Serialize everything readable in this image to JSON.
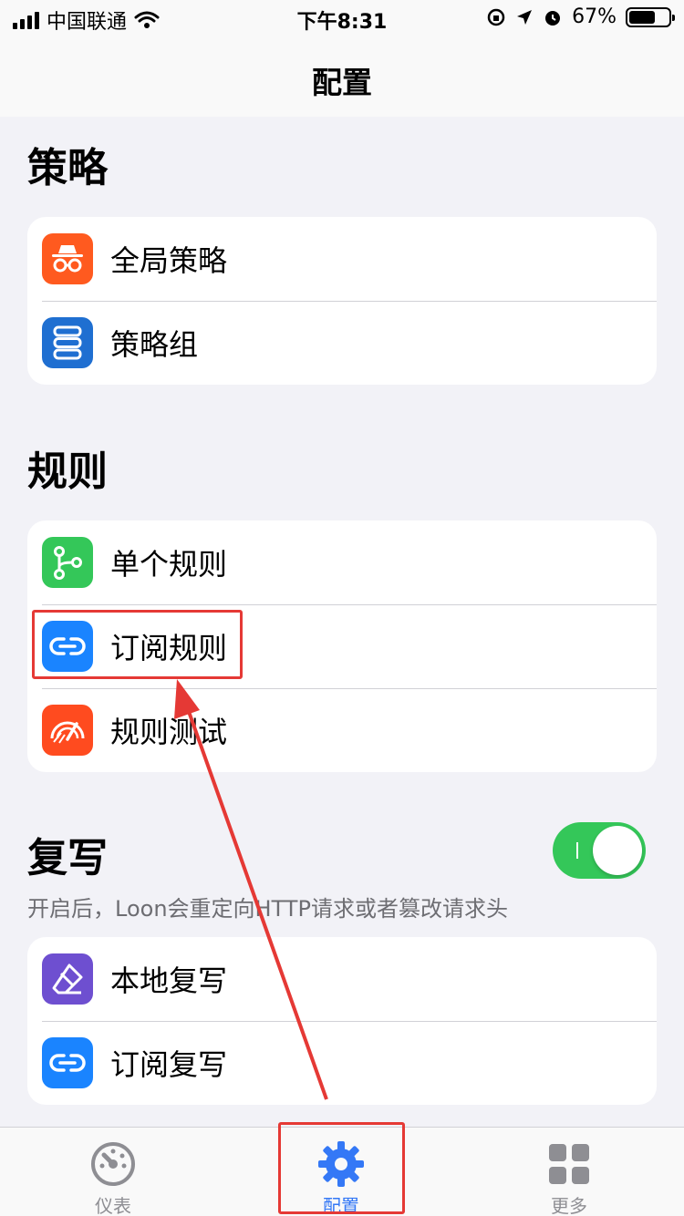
{
  "status": {
    "carrier": "中国联通",
    "time": "下午8:31",
    "battery_percent": "67%",
    "battery_level": 0.67
  },
  "nav": {
    "title": "配置"
  },
  "sections": {
    "strategy": {
      "title": "策略",
      "items": [
        {
          "label": "全局策略",
          "icon": "incognito-icon",
          "color": "#ff5a1f"
        },
        {
          "label": "策略组",
          "icon": "server-stack-icon",
          "color": "#1f6fd1"
        }
      ]
    },
    "rules": {
      "title": "规则",
      "items": [
        {
          "label": "单个规则",
          "icon": "branch-icon",
          "color": "#34c759"
        },
        {
          "label": "订阅规则",
          "icon": "link-icon",
          "color": "#1a84ff"
        },
        {
          "label": "规则测试",
          "icon": "speedometer-icon",
          "color": "#ff4b1f"
        }
      ]
    },
    "rewrite": {
      "title": "复写",
      "toggle_on": true,
      "subtitle": "开启后，Loon会重定向HTTP请求或者篡改请求头",
      "items": [
        {
          "label": "本地复写",
          "icon": "eraser-icon",
          "color": "#6e4fd0"
        },
        {
          "label": "订阅复写",
          "icon": "link-icon",
          "color": "#1a84ff"
        }
      ]
    }
  },
  "tabbar": {
    "tabs": [
      {
        "label": "仪表",
        "icon": "dashboard-icon"
      },
      {
        "label": "配置",
        "icon": "gear-icon",
        "active": true
      },
      {
        "label": "更多",
        "icon": "grid-icon"
      }
    ]
  },
  "colors": {
    "accent": "#3478f6",
    "annotation": "#e53935",
    "toggle_on": "#34c759"
  }
}
